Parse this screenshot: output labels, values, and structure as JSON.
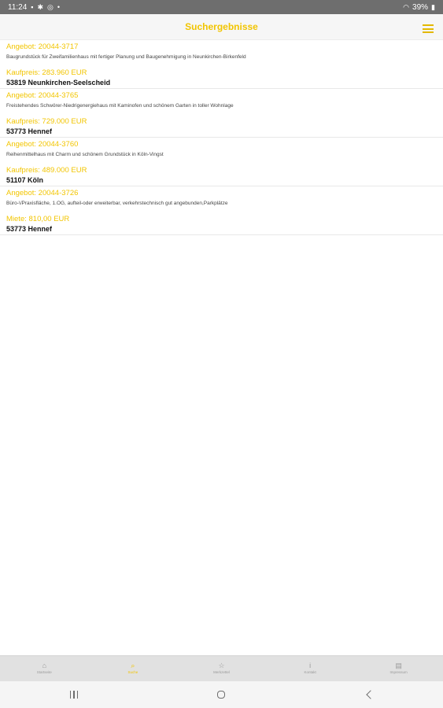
{
  "status_bar": {
    "time": "11:24",
    "battery": "39%",
    "icons": [
      "image-icon",
      "gear-icon",
      "sync-icon",
      "dot-icon",
      "wifi-icon",
      "battery-icon"
    ]
  },
  "header": {
    "title": "Suchergebnisse",
    "menu_icon": "hamburger-menu-icon"
  },
  "results": [
    {
      "offer": "Angebot: 20044-3717",
      "description": "Baugrundstück für Zweifamilienhaus mit fertiger Planung und Baugenehmigung in Neunkirchen-Birkenfeld",
      "price": "Kaufpreis: 283.960 EUR",
      "location": "53819 Neunkirchen-Seelscheid"
    },
    {
      "offer": "Angebot: 20044-3765",
      "description": "Freistehendes Schwörer-Niedrigenergiehaus mit Kaminofen  und  schönem Garten in toller Wohnlage",
      "price": "Kaufpreis: 729.000 EUR",
      "location": "53773 Hennef"
    },
    {
      "offer": "Angebot: 20044-3760",
      "description": "Reihenmittelhaus mit Charm und schönem Grundstück in Köln-Vingst",
      "price": "Kaufpreis: 489.000 EUR",
      "location": "51107 Köln"
    },
    {
      "offer": "Angebot: 20044-3726",
      "description": "Büro-\\/Praxisfläche, 1.OG, aufteil-oder erweiterbar, verkehrstechnisch gut angebunden,Parkplätze",
      "price": "Miete: 810,00 EUR",
      "location": "53773 Hennef"
    }
  ],
  "tabs": [
    {
      "label": "Startseite",
      "icon": "⌂",
      "active": false
    },
    {
      "label": "Suche",
      "icon": "⌕",
      "active": true
    },
    {
      "label": "Merkzettel",
      "icon": "☆",
      "active": false
    },
    {
      "label": "Kontakt",
      "icon": "i",
      "active": false
    },
    {
      "label": "Impressum",
      "icon": "▤",
      "active": false
    }
  ],
  "accent_color": "#f2c500"
}
